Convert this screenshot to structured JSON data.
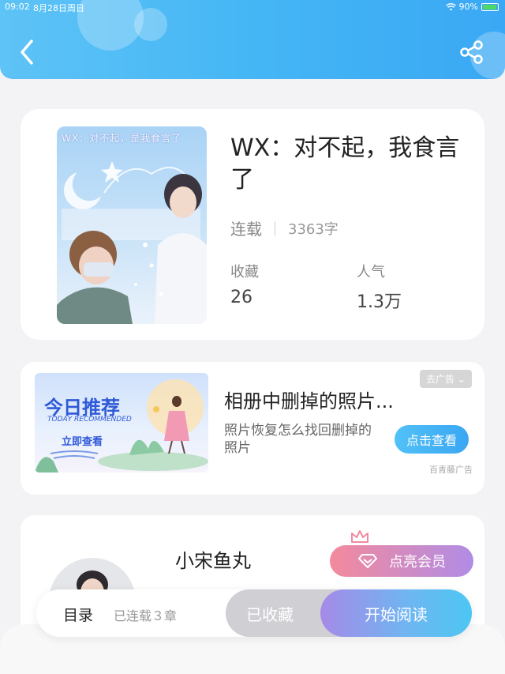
{
  "status_bar": {
    "time": "09:02",
    "date": "8月28日周日",
    "battery": "90%"
  },
  "header": {
    "back_icon": "chevron-left-icon",
    "share_icon": "share-icon",
    "gradient_start": "#5ec3f6",
    "gradient_end": "#3aa8f4"
  },
  "book": {
    "cover_text": "WX：对不起，是我食言了",
    "title": "WX：对不起，我食言了",
    "status": "连载",
    "word_count": "3363字",
    "favorites_label": "收藏",
    "favorites_value": "26",
    "popularity_label": "人气",
    "popularity_value": "1.3万"
  },
  "ad": {
    "image_title": "今日推荐",
    "image_subtitle": "TODAY RECOMMENDED",
    "image_cta": "立即查看",
    "remove_label": "去广告",
    "title": "相册中删掉的照片...",
    "description": "照片恢复怎么找回删掉的照片",
    "button": "点击查看",
    "source": "百青藤广告"
  },
  "author": {
    "name": "小宋鱼丸",
    "vip_button": "点亮会员"
  },
  "bottom_bar": {
    "toc_label": "目录",
    "toc_count": "已连载３章",
    "favorite_button": "已收藏",
    "read_button": "开始阅读"
  },
  "colors": {
    "accent": "#3aa8f4",
    "vip_start": "#f48a9c",
    "vip_end": "#b08ce6"
  }
}
